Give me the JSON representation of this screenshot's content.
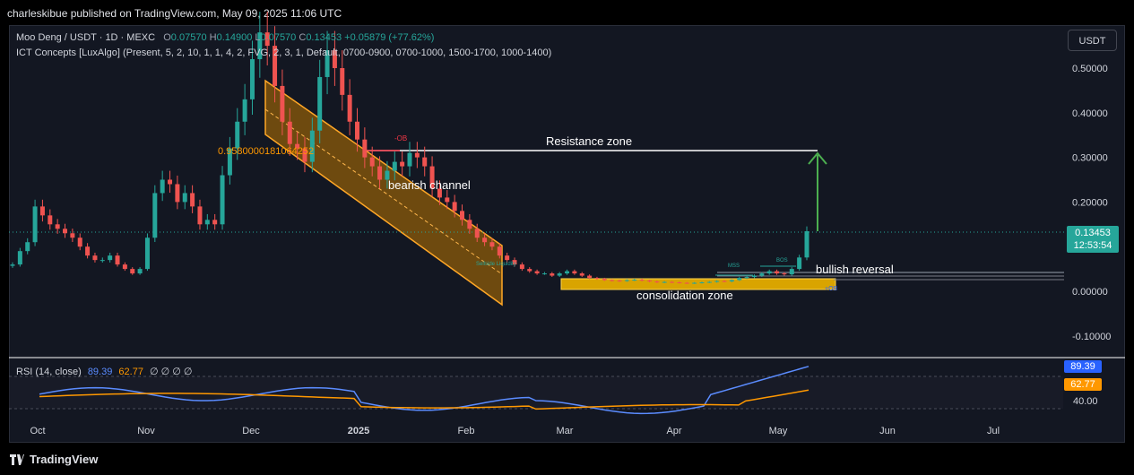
{
  "header": {
    "published": "charleskibue published on TradingView.com, May 09, 2025 11:06 UTC"
  },
  "symbol_legend": {
    "symbol": "Moo Deng / USDT · 1D · MEXC",
    "o_label": "O",
    "o_value": "0.07570",
    "h_label": "H",
    "h_value": "0.14900",
    "l_label": "L",
    "l_value": "0.07570",
    "c_label": "C",
    "c_value": "0.13453",
    "change": "+0.05879 (+77.62%)"
  },
  "indicator_legend": "ICT Concepts [LuxAlgo] (Present, 5, 2, 10, 1, 1, 4, 2, FVG, 2, 3, 1, Default, 0700-0900, 0700-1000, 1500-1700, 1000-1400)",
  "currency_button": "USDT",
  "price_label": {
    "value": "0.13453",
    "countdown": "12:53:54"
  },
  "rsi_panel": {
    "legend": "RSI (14, close)",
    "value": "89.39",
    "ma_value": "62.77",
    "extras": "∅ ∅ ∅ ∅",
    "axis_label": "40.00",
    "colors": {
      "rsi": "#5b8cff",
      "ma": "#ff9800"
    }
  },
  "annotations": {
    "resistance": "Resistance zone",
    "bearish": "bearish channel",
    "bullish": "bullish reversal",
    "consolidation": "consolidation zone",
    "fib": "0.9580000181064252",
    "ob_top": "-OB",
    "mss": "MSS",
    "bos": "BOS",
    "ob_bottom": "+OB",
    "liq": "Sellside Liquidity"
  },
  "footer": {
    "brand": "TradingView"
  },
  "chart_data": {
    "type": "candlestick",
    "title": "Moo Deng / USDT · 1D · MEXC",
    "y_ticks": [
      "0.50000",
      "0.40000",
      "0.30000",
      "0.20000",
      "0.10000",
      "0.00000",
      "-0.10000"
    ],
    "y_tick_values": [
      0.5,
      0.4,
      0.3,
      0.2,
      0.1,
      0.0,
      -0.1
    ],
    "ylim": [
      -0.135,
      0.6
    ],
    "x_ticks": [
      "Oct",
      "Nov",
      "Dec",
      "2025",
      "Feb",
      "Mar",
      "Apr",
      "May",
      "Jun",
      "Jul"
    ],
    "resistance_level": 0.315,
    "consolidation_range": [
      0.006,
      0.03
    ],
    "last_close": 0.13453,
    "closes_approx": [
      0.06,
      0.09,
      0.11,
      0.19,
      0.17,
      0.15,
      0.14,
      0.13,
      0.12,
      0.1,
      0.08,
      0.07,
      0.07,
      0.08,
      0.06,
      0.05,
      0.04,
      0.05,
      0.12,
      0.22,
      0.25,
      0.24,
      0.2,
      0.22,
      0.19,
      0.15,
      0.16,
      0.15,
      0.26,
      0.32,
      0.38,
      0.43,
      0.52,
      0.58,
      0.55,
      0.46,
      0.38,
      0.33,
      0.32,
      0.29,
      0.36,
      0.48,
      0.54,
      0.5,
      0.44,
      0.38,
      0.34,
      0.3,
      0.28,
      0.25,
      0.27,
      0.29,
      0.28,
      0.31,
      0.3,
      0.28,
      0.23,
      0.21,
      0.2,
      0.18,
      0.16,
      0.14,
      0.12,
      0.11,
      0.1,
      0.08,
      0.07,
      0.06,
      0.05,
      0.045,
      0.04,
      0.04,
      0.035,
      0.04,
      0.045,
      0.04,
      0.035,
      0.03,
      0.028,
      0.025,
      0.024,
      0.023,
      0.025,
      0.026,
      0.024,
      0.022,
      0.02,
      0.021,
      0.02,
      0.019,
      0.018,
      0.019,
      0.02,
      0.021,
      0.023,
      0.022,
      0.025,
      0.03,
      0.032,
      0.035,
      0.04,
      0.045,
      0.04,
      0.038,
      0.05,
      0.0757,
      0.1345
    ]
  }
}
